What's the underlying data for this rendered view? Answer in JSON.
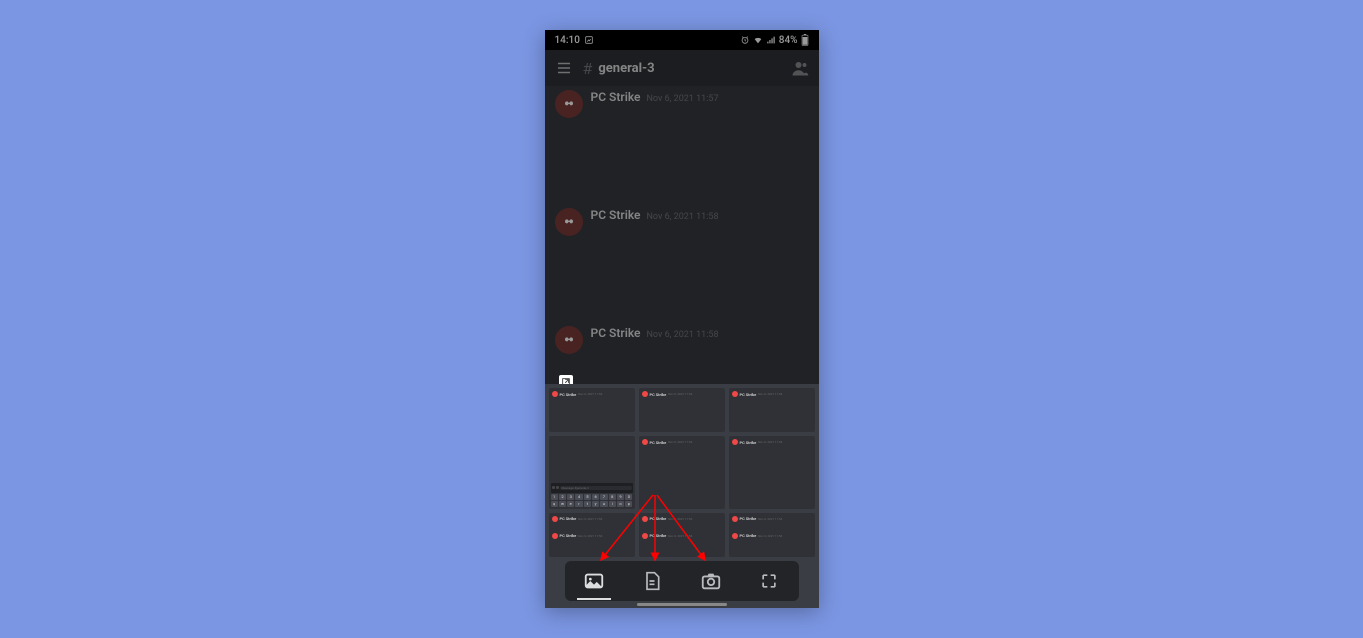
{
  "statusbar": {
    "time": "14:10",
    "battery_percent": "84%",
    "icons": [
      "screenshot",
      "alarm",
      "wifi",
      "signal",
      "battery"
    ]
  },
  "header": {
    "channel_name": "general-3",
    "hash": "#"
  },
  "messages": [
    {
      "author": "PC Strike",
      "timestamp": "Nov 6, 2021 11:57"
    },
    {
      "author": "PC Strike",
      "timestamp": "Nov 6, 2021 11:58"
    },
    {
      "author": "PC Strike",
      "timestamp": "Nov 6, 2021 11:58"
    }
  ],
  "attachment_panel": {
    "thumbnails": [
      {
        "author": "PC Strike",
        "date": "Nov 6, 2021 11:56"
      },
      {
        "author": "PC Strike",
        "date": "Nov 6, 2021 11:56"
      },
      {
        "author": "PC Strike",
        "date": "Nov 6, 2021 11:56"
      },
      {
        "type": "keyboard",
        "placeholder": "Message #general-3"
      },
      {
        "author": "PC Strike",
        "date": "Nov 6, 2021 11:56"
      },
      {
        "author": "PC Strike",
        "date": "Nov 6, 2021 11:56"
      },
      {
        "author": "PC Strike",
        "date": "Nov 6, 2021 11:56"
      },
      {
        "author": "PC Strike",
        "date": "Nov 6, 2021 11:56"
      },
      {
        "author": "PC Strike",
        "date": "Nov 6, 2021 11:56"
      },
      {
        "author": "PC Strike",
        "date": "Nov 6, 2021 11:56"
      },
      {
        "author": "PC Strike",
        "date": "Nov 6, 2021 11:56"
      },
      {
        "author": "PC Strike",
        "date": "Nov 6, 2021 11:56"
      }
    ],
    "tabs": [
      {
        "name": "gallery",
        "active": true
      },
      {
        "name": "files",
        "active": false
      },
      {
        "name": "camera",
        "active": false
      },
      {
        "name": "poll",
        "active": false
      }
    ]
  },
  "keyboard_keys": {
    "row1": [
      "1",
      "2",
      "3",
      "4",
      "5",
      "6",
      "7",
      "8",
      "9",
      "0"
    ],
    "row2": [
      "q",
      "w",
      "e",
      "r",
      "t",
      "y",
      "u",
      "i",
      "o",
      "p"
    ]
  },
  "arrows_color": "#ff0000"
}
